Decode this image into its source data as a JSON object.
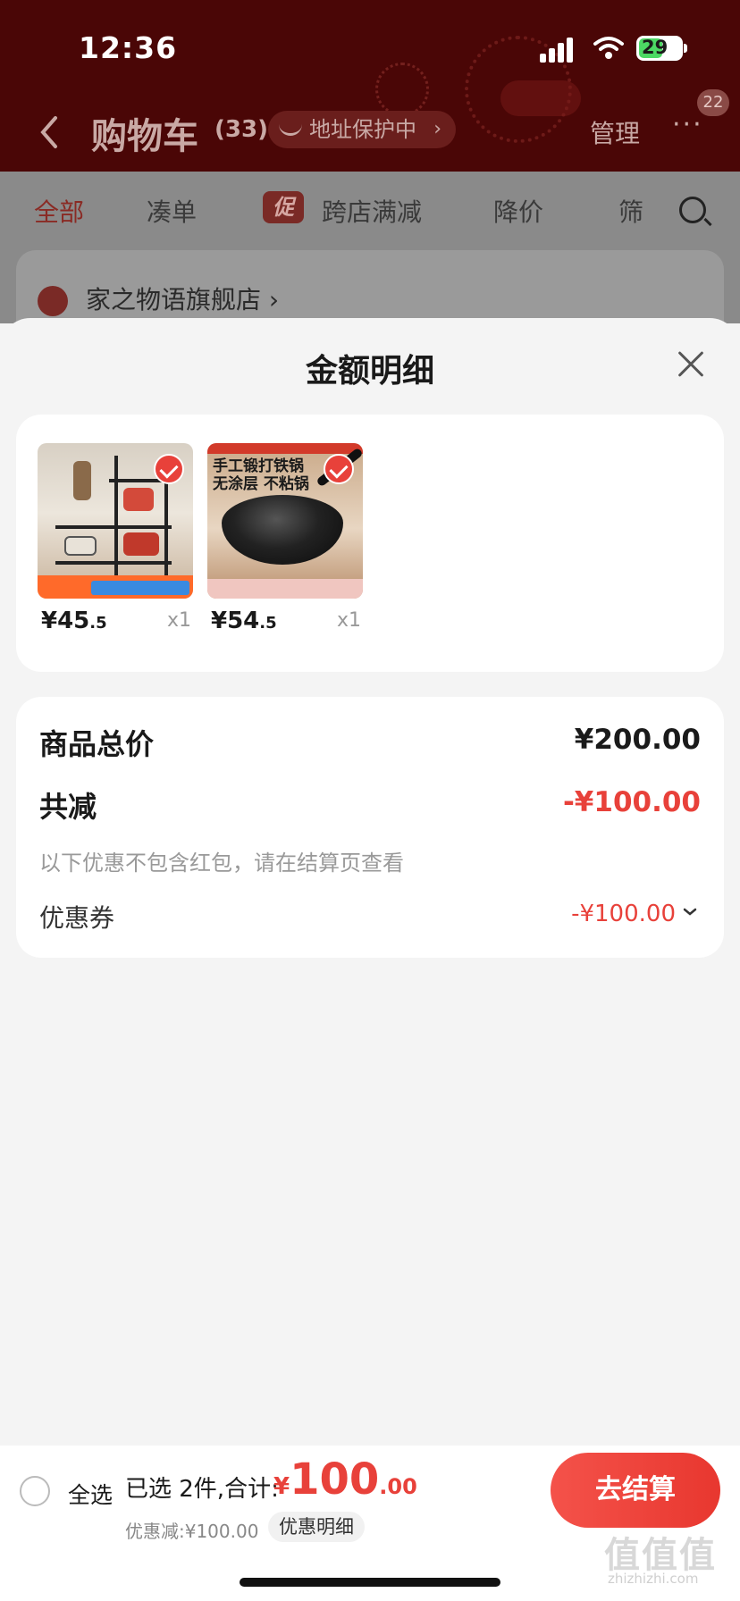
{
  "status_bar": {
    "time": "12:36",
    "battery": "29"
  },
  "nav": {
    "title": "购物车",
    "count": "(33)",
    "address_protect": "地址保护中",
    "manage": "管理",
    "more_badge": "22"
  },
  "tabs": [
    {
      "label": "全部",
      "active": true
    },
    {
      "label": "凑单"
    },
    {
      "label": "跨店满减",
      "tag": "促"
    },
    {
      "label": "降价"
    },
    {
      "label": "筛"
    }
  ],
  "shop": {
    "name": "家之物语旗舰店 ›"
  },
  "sheet": {
    "title": "金额明细",
    "products": [
      {
        "name": "kitchen-rack",
        "price_int": "¥45",
        "price_dec": ".5",
        "qty": "x1"
      },
      {
        "name": "iron-wok",
        "price_int": "¥54",
        "price_dec": ".5",
        "qty": "x1",
        "image_text": "手工锻打铁锅\n无涂层 不粘锅"
      }
    ],
    "summary": {
      "total_label": "商品总价",
      "total_value": "¥200.00",
      "reduce_label": "共减",
      "reduce_value": "-¥100.00",
      "note": "以下优惠不包含红包，请在结算页查看",
      "coupon_label": "优惠券",
      "coupon_value": "-¥100.00"
    }
  },
  "bottom_bar": {
    "select_all": "全选",
    "selected_text": "已选 2件,合计:",
    "currency": "¥",
    "total_int": "100",
    "total_dec": ".00",
    "discount_line": "优惠减:¥100.00",
    "detail_chip": "优惠明细",
    "checkout": "去结算"
  },
  "watermark": {
    "text": "值值值",
    "sub": "zhizhizhi.com"
  },
  "colors": {
    "accent": "#e8413a",
    "header_bg": "#4a0606"
  }
}
